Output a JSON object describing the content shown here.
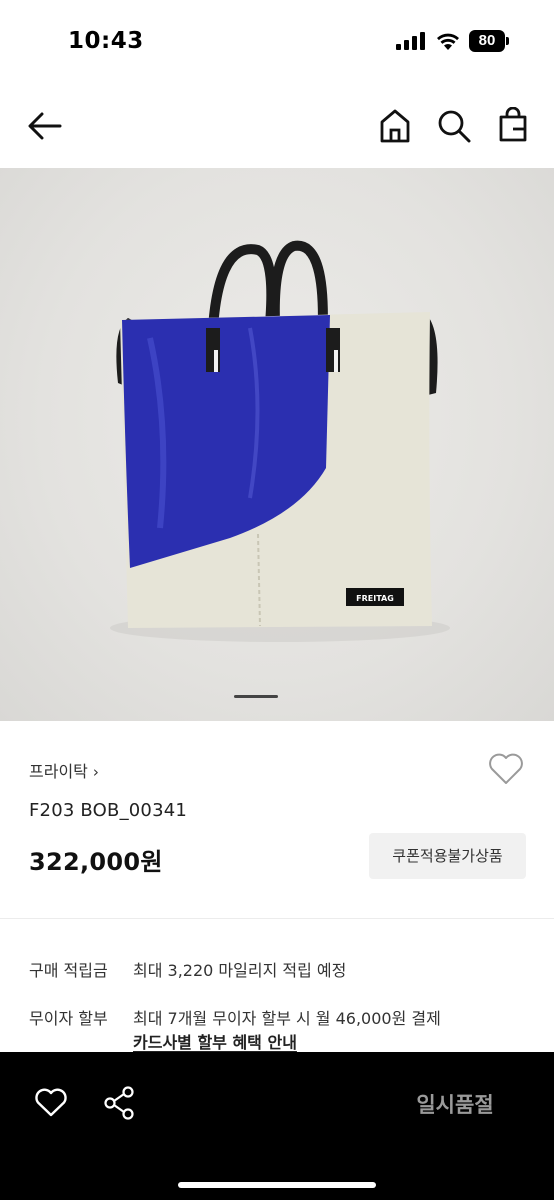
{
  "status_bar": {
    "time": "10:43",
    "battery": "80"
  },
  "nav": {
    "icons": [
      "back-arrow-icon",
      "home-icon",
      "search-icon",
      "shopping-bag-icon"
    ]
  },
  "product": {
    "brand": "프라이탁",
    "brand_chevron": "›",
    "name": "F203 BOB_00341",
    "price": "322,000",
    "price_unit": "원",
    "coupon_notice": "쿠폰적용불가상품",
    "bag_label": "FREITAG",
    "colors": {
      "bag_blue": "#2b2fb0",
      "bag_cream": "#e6e4d7",
      "strap": "#1c1c1c"
    }
  },
  "benefits": {
    "points_label": "구매 적립금",
    "points_value": "최대 3,220 마일리지 적립 예정",
    "installment_label": "무이자 할부",
    "installment_value": "최대 7개월 무이자 할부 시 월 46,000원 결제",
    "card_link": "카드사별 할부 혜택 안내"
  },
  "bottom_bar": {
    "action_label": "일시품절",
    "icons": [
      "heart-icon",
      "share-icon"
    ]
  }
}
